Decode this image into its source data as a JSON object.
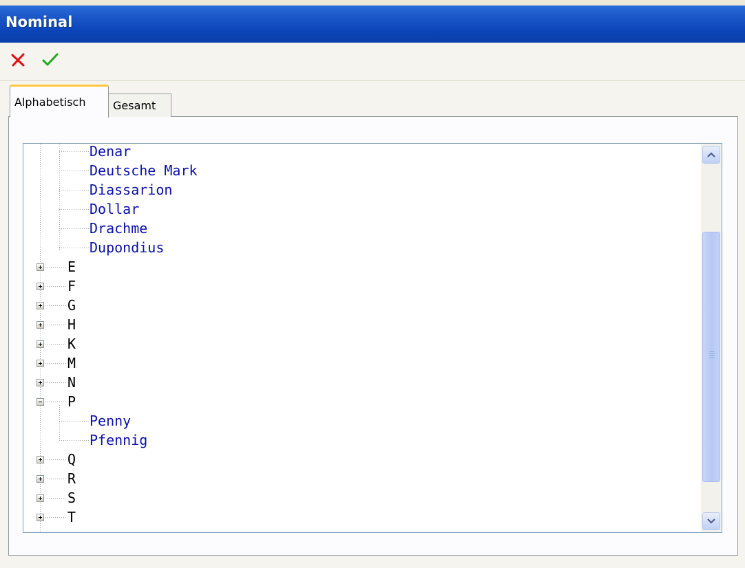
{
  "window": {
    "title": "Nominal"
  },
  "toolbar": {
    "cancel_icon": "red-x-icon",
    "ok_icon": "green-check-icon"
  },
  "colors": {
    "title_bar": "#0a44b8",
    "leaf_text": "#0a10a8",
    "active_tab_accent": "#ffc83c"
  },
  "tabs": [
    {
      "label": "Alphabetisch",
      "active": true
    },
    {
      "label": "Gesamt",
      "active": false
    }
  ],
  "tree": {
    "d_children": [
      "Denar",
      "Deutsche Mark",
      "Diassarion",
      "Dollar",
      "Drachme",
      "Dupondius"
    ],
    "groups_before_p": [
      "E",
      "F",
      "G",
      "H",
      "K",
      "M",
      "N"
    ],
    "p_group": {
      "label": "P",
      "expanded": true,
      "children": [
        "Penny",
        "Pfennig"
      ]
    },
    "groups_after_p": [
      "Q",
      "R",
      "S",
      "T"
    ]
  }
}
